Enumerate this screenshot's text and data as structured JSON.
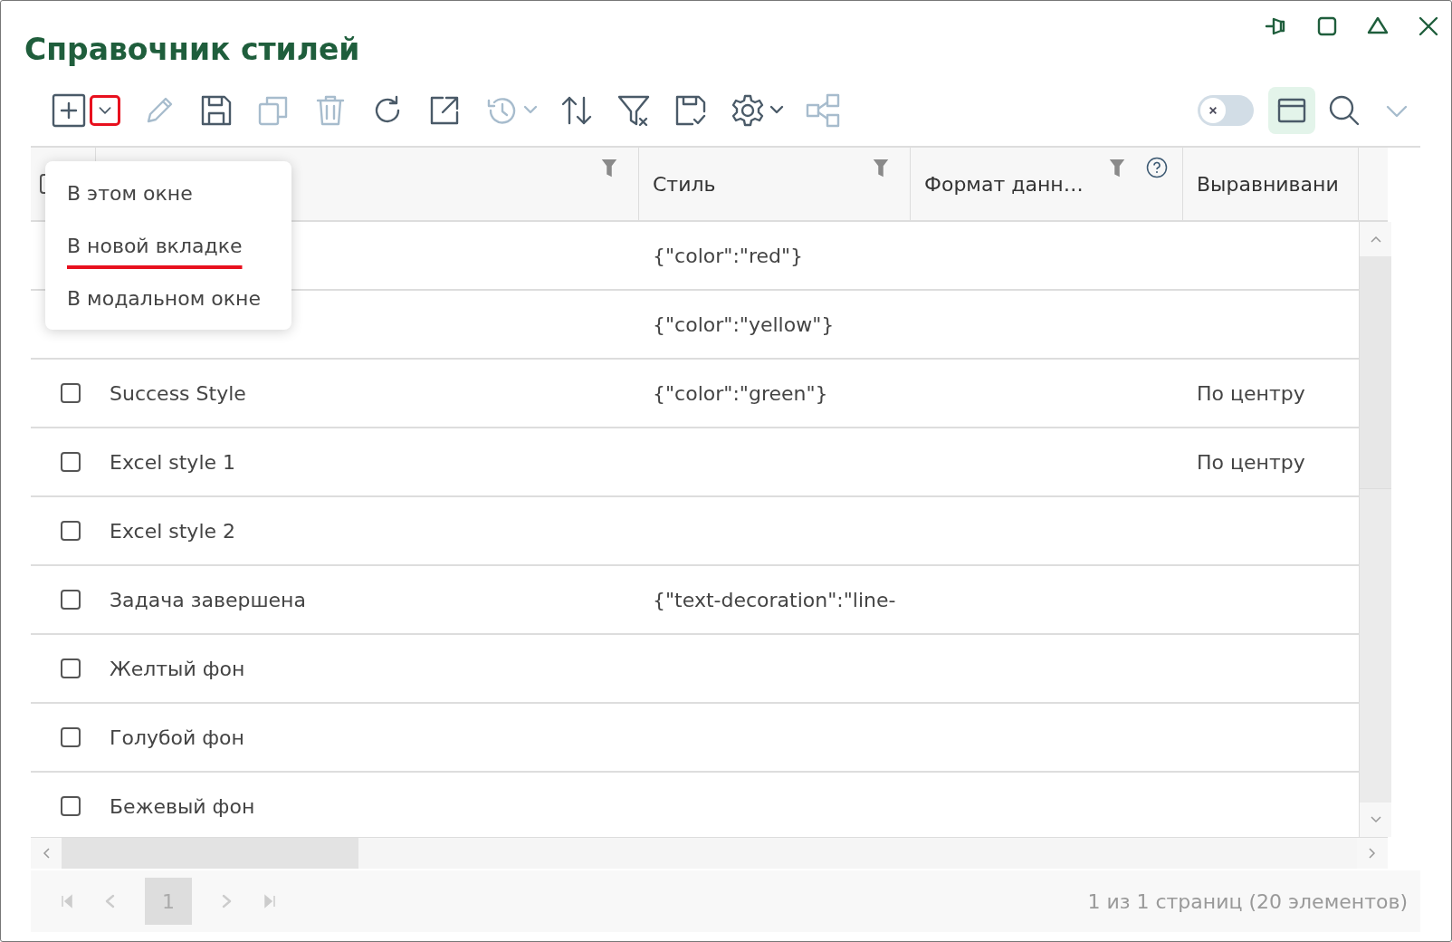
{
  "window": {
    "title": "Справочник стилей",
    "controls": [
      {
        "kind": "pin"
      },
      {
        "kind": "maximize"
      },
      {
        "kind": "collapse"
      },
      {
        "kind": "close"
      }
    ]
  },
  "toolbar": {
    "left": [
      {
        "kind": "add",
        "disabled": false
      },
      {
        "kind": "caret",
        "disabled": false,
        "highlighted": true
      },
      {
        "kind": "edit",
        "disabled": true
      },
      {
        "kind": "save",
        "disabled": false
      },
      {
        "kind": "copy",
        "disabled": true
      },
      {
        "kind": "delete",
        "disabled": true
      },
      {
        "kind": "refresh",
        "disabled": false
      },
      {
        "kind": "open-external",
        "disabled": false
      },
      {
        "kind": "history",
        "disabled": true
      },
      {
        "kind": "sort",
        "disabled": false
      },
      {
        "kind": "clear-filter",
        "disabled": false
      },
      {
        "kind": "save-check",
        "disabled": false
      },
      {
        "kind": "settings",
        "disabled": false
      },
      {
        "kind": "share",
        "disabled": true
      }
    ],
    "toggle": {
      "on": false
    },
    "right": [
      {
        "kind": "layout",
        "selected": true
      },
      {
        "kind": "search",
        "selected": false
      },
      {
        "kind": "more",
        "selected": false
      }
    ]
  },
  "dropdown_menu": [
    {
      "label": "В этом окне",
      "marked": false
    },
    {
      "label": "В новой вкладке",
      "marked": true
    },
    {
      "label": "В модальном окне",
      "marked": false
    }
  ],
  "table": {
    "all_checked": false,
    "columns": [
      {
        "filter": true
      },
      {
        "label": "Стиль",
        "filter": true
      },
      {
        "label": "Формат данн…",
        "filter": true,
        "help": true
      },
      {
        "label": "Выравнивани"
      }
    ],
    "rows": [
      {
        "style": "{\"color\":\"red\"}"
      },
      {
        "style": "{\"color\":\"yellow\"}"
      },
      {
        "checked": false,
        "name": "Success Style",
        "style": "{\"color\":\"green\"}",
        "align": "По центру"
      },
      {
        "checked": false,
        "name": "Excel style 1",
        "align": "По центру"
      },
      {
        "checked": false,
        "name": "Excel style 2"
      },
      {
        "checked": false,
        "name": "Задача завершена",
        "style": "{\"text-decoration\":\"line-"
      },
      {
        "checked": false,
        "name": "Желтый фон"
      },
      {
        "checked": false,
        "name": "Голубой фон"
      },
      {
        "checked": false,
        "name": "Бежевый фон"
      }
    ]
  },
  "pager": {
    "buttons": [
      {
        "kind": "first",
        "disabled": true
      },
      {
        "kind": "prev",
        "disabled": true
      },
      {
        "kind": "page",
        "label": "1",
        "selected": true
      },
      {
        "kind": "next",
        "disabled": true
      },
      {
        "kind": "last",
        "disabled": true
      }
    ],
    "summary": "1 из 1 страниц (20 элементов)"
  }
}
